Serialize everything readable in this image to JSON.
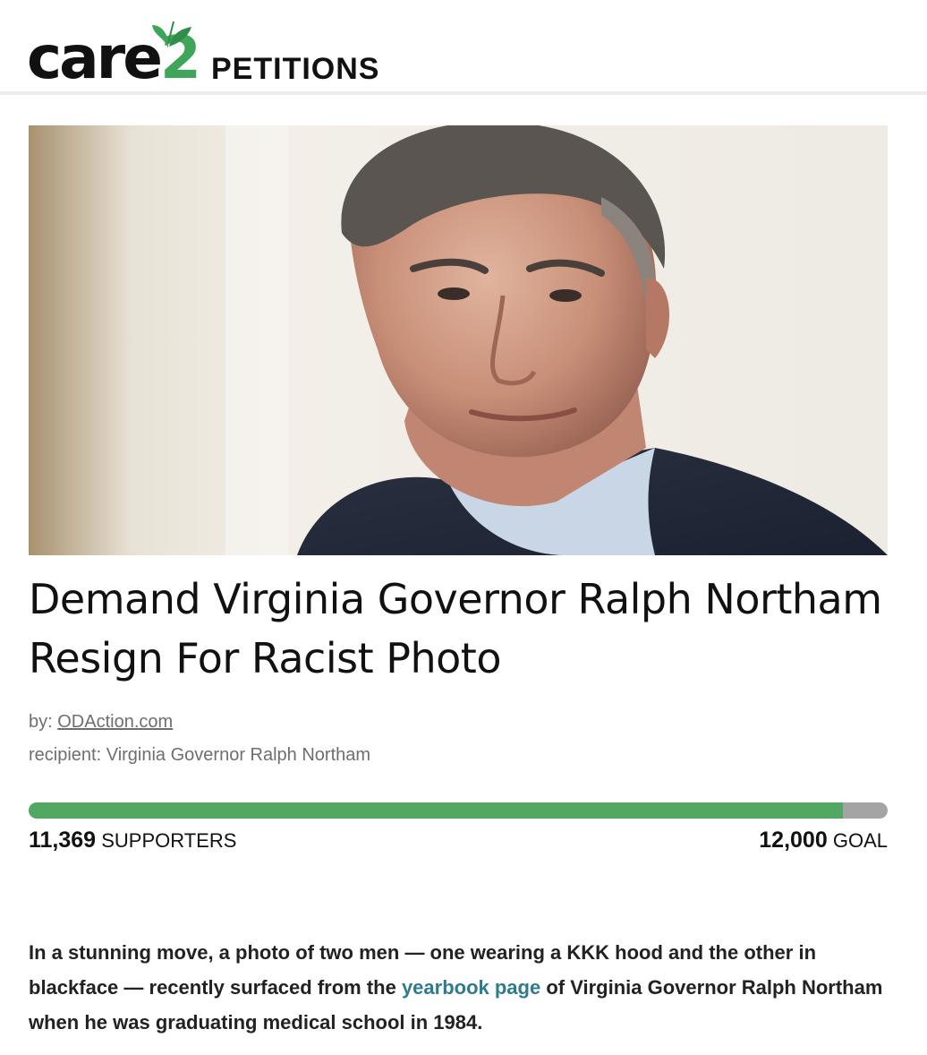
{
  "header": {
    "logo_word": "care",
    "logo_number": "2",
    "section": "PETITIONS"
  },
  "hero": {
    "icon": "portrait-photo"
  },
  "petition": {
    "title": "Demand Virginia Governor Ralph Northam Resign For Racist Photo",
    "by_label": "by:",
    "author": "ODAction.com",
    "recipient_label": "recipient:",
    "recipient": "Virginia Governor Ralph Northam"
  },
  "progress": {
    "supporters_count": "11,369",
    "supporters_label": "SUPPORTERS",
    "goal_count": "12,000",
    "goal_label": "GOAL",
    "fraction": 0.9474
  },
  "body": {
    "text_before": "In a stunning move, a photo of two men — one wearing a KKK hood and the other in blackface — recently surfaced from the ",
    "link_text": "yearbook page",
    "text_after": " of Virginia Governor Ralph Northam when he was graduating medical school in 1984."
  },
  "colors": {
    "brand_green": "#3fa55b",
    "progress_fill": "#52a860",
    "progress_track": "#a4a4a4",
    "link": "#2f7a8e"
  }
}
